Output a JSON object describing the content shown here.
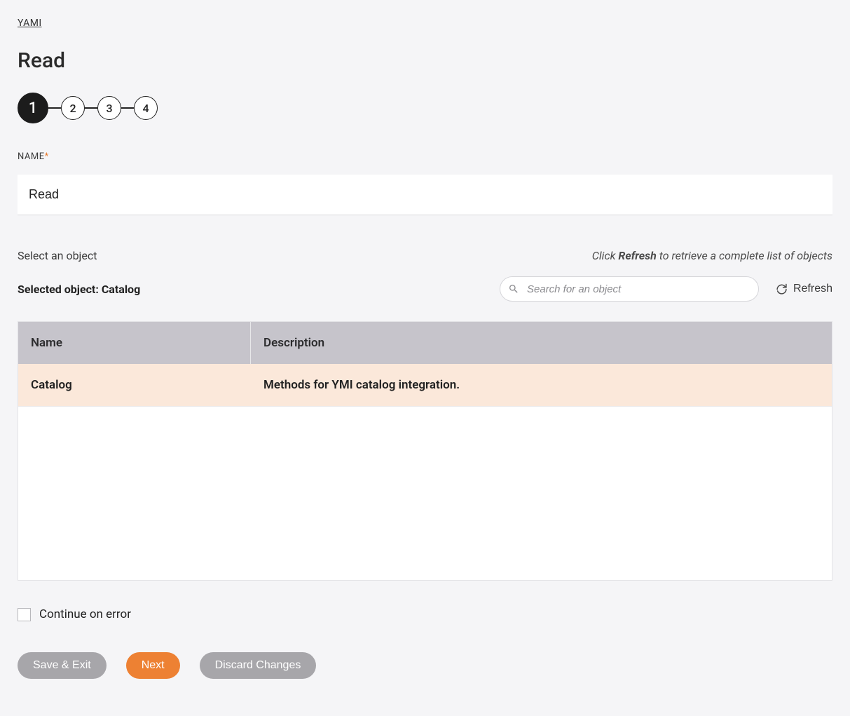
{
  "breadcrumb": "YAMI",
  "page_title": "Read",
  "steps": [
    "1",
    "2",
    "3",
    "4"
  ],
  "active_step_index": 0,
  "name_field": {
    "label": "NAME",
    "required_marker": "*",
    "value": "Read"
  },
  "object_section": {
    "select_label": "Select an object",
    "hint_prefix": "Click ",
    "hint_bold": "Refresh",
    "hint_suffix": " to retrieve a complete list of objects",
    "selected_prefix": "Selected object: ",
    "selected_value": "Catalog",
    "search_placeholder": "Search for an object",
    "refresh_label": "Refresh"
  },
  "table": {
    "headers": {
      "name": "Name",
      "description": "Description"
    },
    "rows": [
      {
        "name": "Catalog",
        "description": "Methods for YMI catalog integration."
      }
    ]
  },
  "continue_on_error_label": "Continue on error",
  "buttons": {
    "save_exit": "Save & Exit",
    "next": "Next",
    "discard": "Discard Changes"
  }
}
